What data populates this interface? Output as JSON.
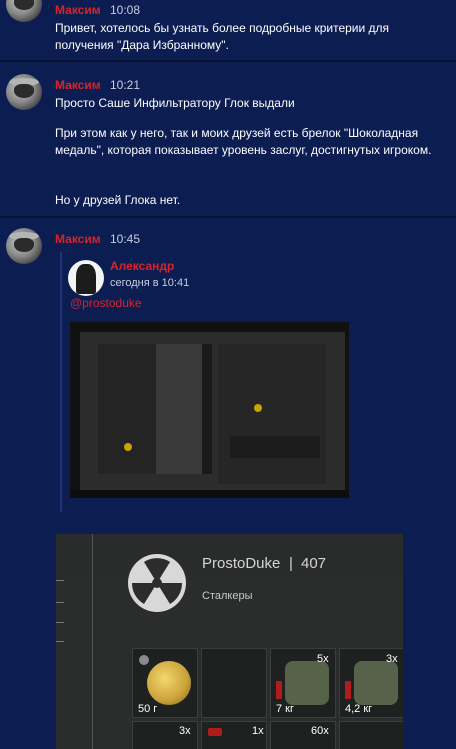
{
  "messages": [
    {
      "author": "Максим",
      "time": "10:08",
      "paragraphs": [
        "Привет, хотелось бы узнать более подробные критерии для получения \"Дара Избранному\"."
      ]
    },
    {
      "author": "Максим",
      "time": "10:21",
      "paragraphs": [
        "Просто Саше Инфильтратору Глок выдали",
        "При этом как у него, так и моих друзей есть брелок \"Шоколадная медаль\", которая показывает уровень заслуг, достигнутых игроком.",
        "Но у друзей Глока нет."
      ]
    },
    {
      "author": "Максим",
      "time": "10:45",
      "quote": {
        "author": "Александр",
        "date": "сегодня в 10:41",
        "mention": "@prostoduke"
      },
      "screenshot": {
        "player_name": "ProstoDuke",
        "separator": "|",
        "level": "407",
        "faction": "Сталкеры",
        "items": [
          {
            "weight": "50 г",
            "count": ""
          },
          {
            "weight": "",
            "count": ""
          },
          {
            "weight": "7 кг",
            "count": "5x"
          },
          {
            "weight": "4,2 кг",
            "count": "3x"
          }
        ],
        "bottom_counts": [
          "3x",
          "1x",
          "60x"
        ]
      }
    }
  ],
  "colors": {
    "background": "#0c1d52",
    "author": "#d8232a",
    "text": "#ffffff"
  }
}
